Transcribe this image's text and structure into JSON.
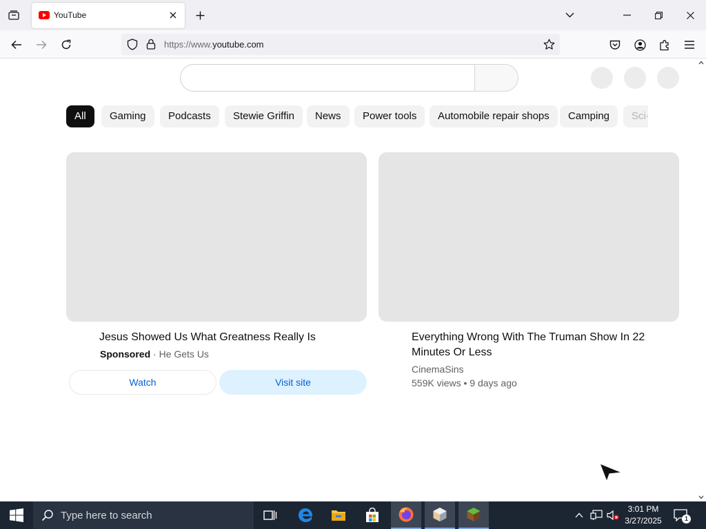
{
  "browser": {
    "tab": {
      "title": "YouTube"
    },
    "url": {
      "prefix": "https://www.",
      "domain": "youtube.com"
    }
  },
  "page": {
    "chips": [
      {
        "label": "All"
      },
      {
        "label": "Gaming"
      },
      {
        "label": "Podcasts"
      },
      {
        "label": "Stewie Griffin"
      },
      {
        "label": "News"
      },
      {
        "label": "Power tools"
      },
      {
        "label": "Automobile repair shops"
      },
      {
        "label": "Camping"
      },
      {
        "label": "Sci-"
      }
    ],
    "videos": [
      {
        "title": "Jesus Showed Us What Greatness Really Is",
        "sponsored_label": "Sponsored",
        "separator": " · ",
        "channel": "He Gets Us",
        "watch_label": "Watch",
        "visit_label": "Visit site"
      },
      {
        "title_line1": "Everything Wrong With The Truman Show In 22",
        "title_line2": "Minutes Or Less",
        "channel": "CinemaSins",
        "stats": "559K views • 9 days ago"
      }
    ]
  },
  "taskbar": {
    "search_placeholder": "Type here to search",
    "time": "3:01 PM",
    "date": "3/27/2025",
    "notification_count": "1"
  }
}
